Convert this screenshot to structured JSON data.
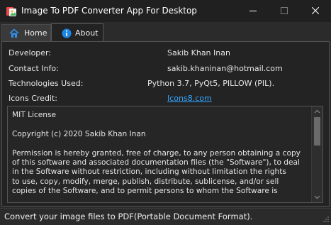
{
  "window": {
    "title": "Image To PDF Converter App For Desktop",
    "accent": "#33a6ff"
  },
  "tabs": [
    {
      "label": "Home",
      "icon": "home-icon"
    },
    {
      "label": "About",
      "icon": "info-icon",
      "selected": true
    }
  ],
  "about": {
    "developer_label": "Developer:",
    "developer_value": "Sakib Khan Inan",
    "contact_label": "Contact Info:",
    "contact_value": "sakib.khaninan@hotmail.com",
    "tech_label": "Technologies Used:",
    "tech_value": "Python 3.7, PyQt5, PILLOW (PIL).",
    "icons_label": "Icons Credit:",
    "icons_value": "Icons8.com"
  },
  "license": {
    "text": "MIT License\n\nCopyright (c) 2020 Sakib Khan Inan\n\nPermission is hereby granted, free of charge, to any person obtaining a copy\nof this software and associated documentation files (the \"Software\"), to deal\nin the Software without restriction, including without limitation the rights\nto use, copy, modify, merge, publish, distribute, sublicense, and/or sell\ncopies of the Software, and to permit persons to whom the Software is"
  },
  "status": {
    "text": "Convert your image files to PDF(Portable Document Format)."
  }
}
